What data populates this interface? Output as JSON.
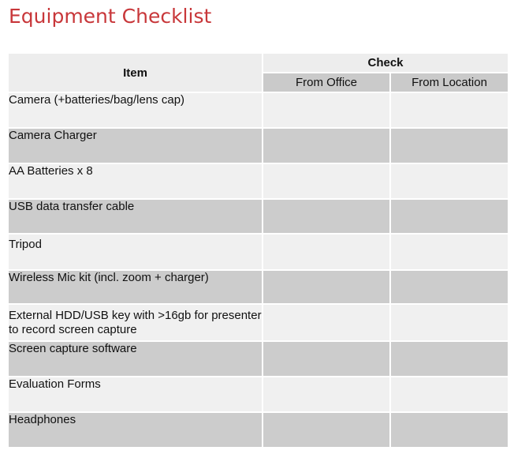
{
  "title": "Equipment Checklist",
  "header": {
    "item": "Item",
    "check": "Check",
    "from_office": "From Office",
    "from_location": "From Location"
  },
  "rows": [
    {
      "item": "Camera (+batteries/bag/lens cap)"
    },
    {
      "item": "Camera Charger"
    },
    {
      "item": "AA Batteries x 8"
    },
    {
      "item": "USB data transfer cable"
    },
    {
      "item": "Tripod"
    },
    {
      "item": "Wireless Mic kit (incl. zoom + charger)"
    },
    {
      "item": "External HDD/USB key with >16gb for presenter to record screen capture"
    },
    {
      "item": "Screen capture software"
    },
    {
      "item": "Evaluation Forms"
    },
    {
      "item": "Headphones"
    }
  ],
  "colors": {
    "title": "#c8373a",
    "row_light": "#f0f0f0",
    "row_dark": "#cccccc"
  }
}
